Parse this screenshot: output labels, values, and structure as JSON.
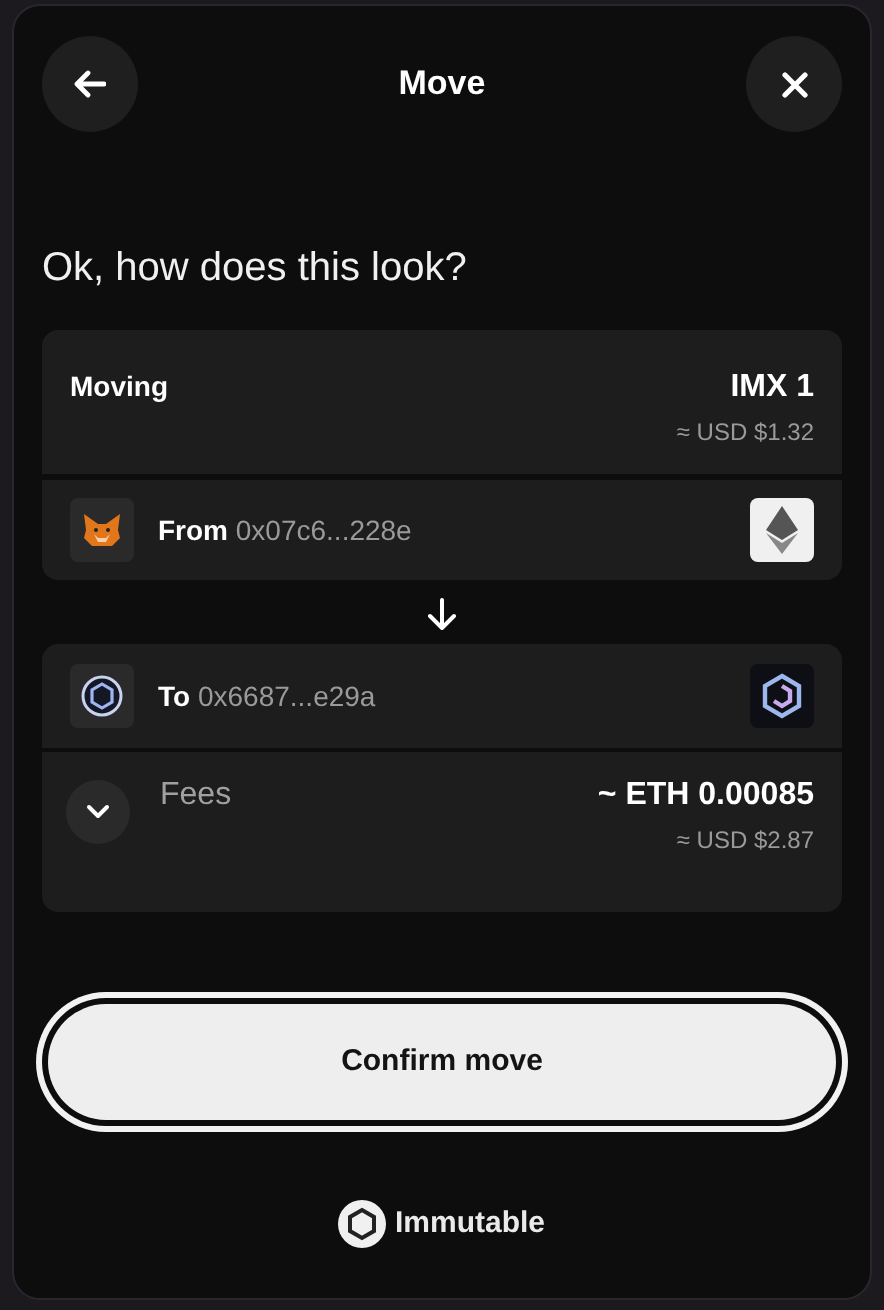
{
  "header": {
    "title": "Move"
  },
  "heading": "Ok, how does this look?",
  "moving": {
    "label": "Moving",
    "amount": "IMX 1",
    "fiat": "≈ USD $1.32"
  },
  "from": {
    "label": "From",
    "address": "0x07c6...228e"
  },
  "to": {
    "label": "To",
    "address": "0x6687...e29a"
  },
  "fees": {
    "label": "Fees",
    "expanded": false,
    "amount": "~ ETH 0.00085",
    "fiat": "≈ USD $2.87"
  },
  "confirm_button": {
    "label": "Confirm move",
    "focused": true
  },
  "footer": {
    "brand": "Immutable"
  }
}
